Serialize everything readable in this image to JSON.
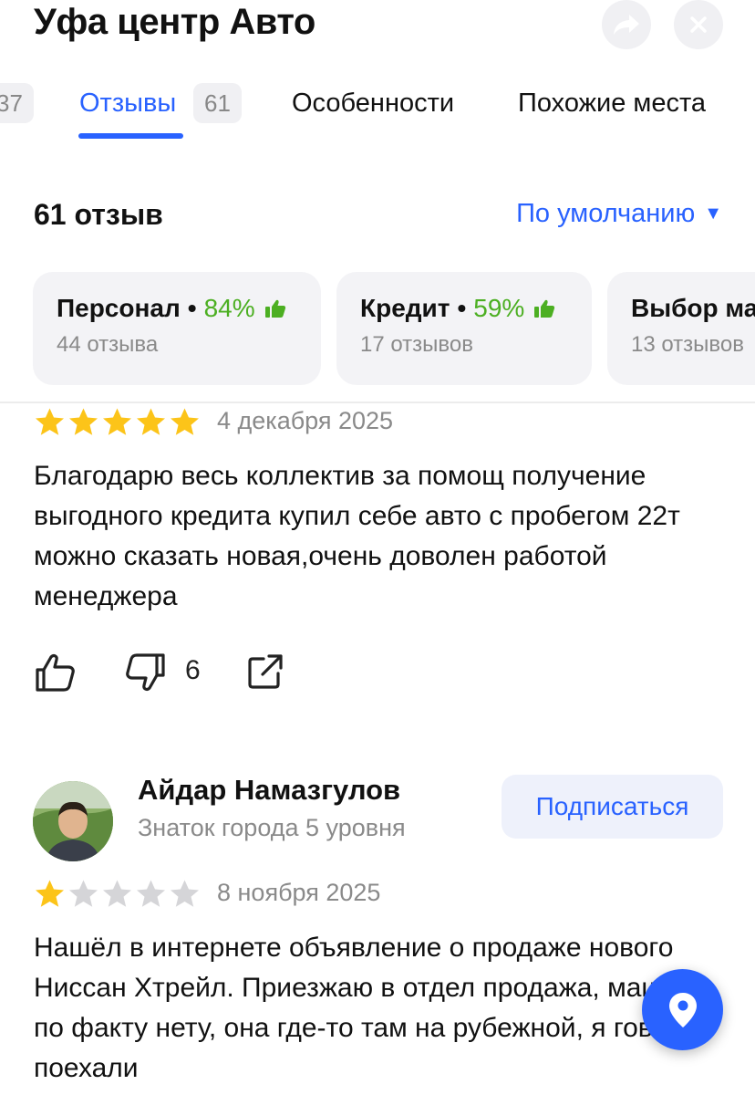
{
  "header": {
    "title": "Уфа центр Авто",
    "share_icon": "share-icon",
    "close_icon": "close-icon"
  },
  "tabs": {
    "prev_badge": "37",
    "active_label": "Отзывы",
    "active_badge": "61",
    "features_label": "Особенности",
    "similar_label": "Похожие места",
    "accent": "#2962ff"
  },
  "reviews_header": {
    "count_text": "61 отзыв",
    "sort_label": "По умолчанию",
    "sort_caret": "▼"
  },
  "aspects": [
    {
      "name": "Персонал",
      "percent": "84%",
      "sub": "44 отзыва"
    },
    {
      "name": "Кредит",
      "percent": "59%",
      "sub": "17 отзывов"
    },
    {
      "name": "Выбор маши",
      "percent": "",
      "sub": "13 отзывов"
    }
  ],
  "reviews": [
    {
      "rating": 5,
      "date": "4 декабря 2025",
      "text": "Благодарю весь коллектив за помощ получение выгодного кредита купил себе авто с пробегом 22т можно сказать новая,очень доволен работой менеджера",
      "dislikes": "6"
    },
    {
      "author": "Айдар Намазгулов",
      "level": "Знаток города 5 уровня",
      "subscribe_label": "Подписаться",
      "rating": 1,
      "date": "8 ноября 2025",
      "text": "Нашёл в интернете объявление о продаже нового Ниссан Хтрейл. Приезжаю в отдел продажа, машины по факту нету, она где-то там на рубежной, я говорю поехали"
    }
  ],
  "colors": {
    "star_active": "#fcc419",
    "star_inactive": "#d5d5d8",
    "positive": "#4caf22",
    "fab": "#2962ff"
  },
  "fab_icon": "map-pin-icon"
}
